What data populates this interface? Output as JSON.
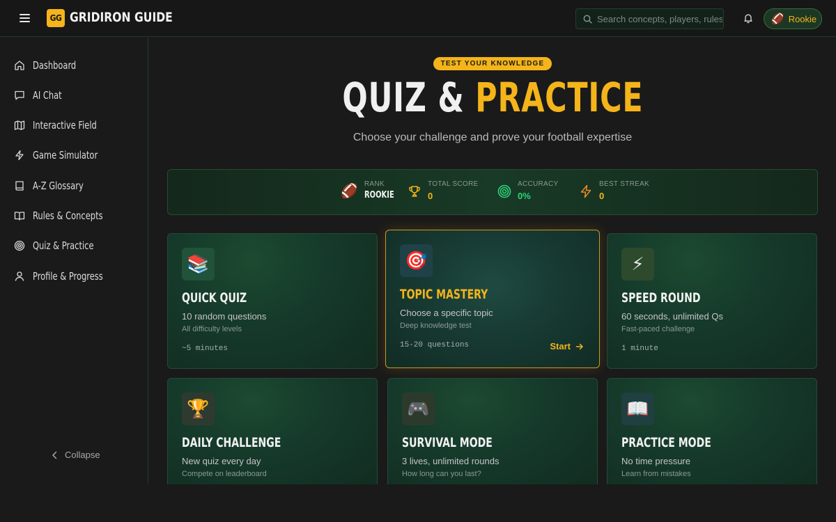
{
  "header": {
    "logo_badge": "GG",
    "app_title": "GRIDIRON GUIDE",
    "search_placeholder": "Search concepts, players, rules",
    "rank_pill": "Rookie"
  },
  "sidebar": {
    "items": [
      {
        "label": "Dashboard",
        "icon": "home-icon"
      },
      {
        "label": "AI Chat",
        "icon": "chat-icon"
      },
      {
        "label": "Interactive Field",
        "icon": "map-icon"
      },
      {
        "label": "Game Simulator",
        "icon": "lightning-icon"
      },
      {
        "label": "A-Z Glossary",
        "icon": "book-icon"
      },
      {
        "label": "Rules & Concepts",
        "icon": "open-book-icon"
      },
      {
        "label": "Quiz & Practice",
        "icon": "target-icon"
      },
      {
        "label": "Profile & Progress",
        "icon": "user-icon"
      }
    ],
    "collapse_label": "Collapse"
  },
  "hero": {
    "eyebrow": "TEST YOUR KNOWLEDGE",
    "title_part1": "QUIZ & ",
    "title_part2": "PRACTICE",
    "subtitle": "Choose your challenge and prove your football expertise"
  },
  "stats": {
    "rank": {
      "label": "RANK",
      "value": "ROOKIE"
    },
    "total_score": {
      "label": "TOTAL SCORE",
      "value": "0"
    },
    "accuracy": {
      "label": "ACCURACY",
      "value": "0%"
    },
    "best_streak": {
      "label": "BEST STREAK",
      "value": "0"
    }
  },
  "modes": [
    {
      "title": "QUICK QUIZ",
      "desc": "10 random questions",
      "sub": "All difficulty levels",
      "time": "~5 minutes",
      "emoji": "📚",
      "icon_bg": "#21523a"
    },
    {
      "title": "TOPIC MASTERY",
      "desc": "Choose a specific topic",
      "sub": "Deep knowledge test",
      "time": "15-20 questions",
      "emoji": "🎯",
      "icon_bg": "#1f4248",
      "start": "Start"
    },
    {
      "title": "SPEED ROUND",
      "desc": "60 seconds, unlimited Qs",
      "sub": "Fast-paced challenge",
      "time": "1 minute",
      "emoji": "⚡",
      "icon_bg": "#2d4a2c"
    },
    {
      "title": "DAILY CHALLENGE",
      "desc": "New quiz every day",
      "sub": "Compete on leaderboard",
      "emoji": "🏆",
      "icon_bg": "#2e3a30"
    },
    {
      "title": "SURVIVAL MODE",
      "desc": "3 lives, unlimited rounds",
      "sub": "How long can you last?",
      "emoji": "🎮",
      "icon_bg": "#2c3a2c"
    },
    {
      "title": "PRACTICE MODE",
      "desc": "No time pressure",
      "sub": "Learn from mistakes",
      "emoji": "📖",
      "icon_bg": "#1f3f40"
    }
  ],
  "colors": {
    "accent": "#f4b41a",
    "background": "#1a1a1a",
    "card_green": "#15392a",
    "success": "#2fd37a"
  }
}
